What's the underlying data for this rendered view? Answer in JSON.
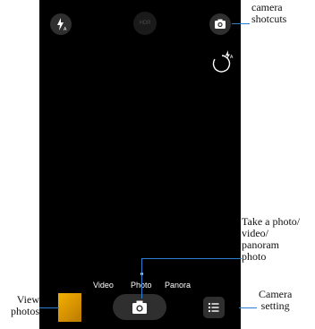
{
  "camera": {
    "hdr_label": "HDR",
    "modes": [
      "Video",
      "Photo",
      "Panora"
    ],
    "selected_mode": "Photo"
  },
  "icons": {
    "flash": "flash-auto-icon",
    "hdr": "hdr-icon",
    "switch": "camera-switch-icon",
    "timer": "timer-flash-icon",
    "shutter": "camera-icon",
    "settings": "menu-list-icon"
  },
  "annotations": {
    "shortcuts": [
      "camera",
      "shotcuts"
    ],
    "capture": [
      "Take a photo/",
      "video/",
      "panoram",
      "photo"
    ],
    "setting": [
      "Camera",
      "setting"
    ],
    "view": [
      "View",
      "photos"
    ]
  },
  "colors": {
    "callout_line": "#2b7fd0",
    "viewfinder": "#000000",
    "thumbnail": "#e0a000"
  }
}
